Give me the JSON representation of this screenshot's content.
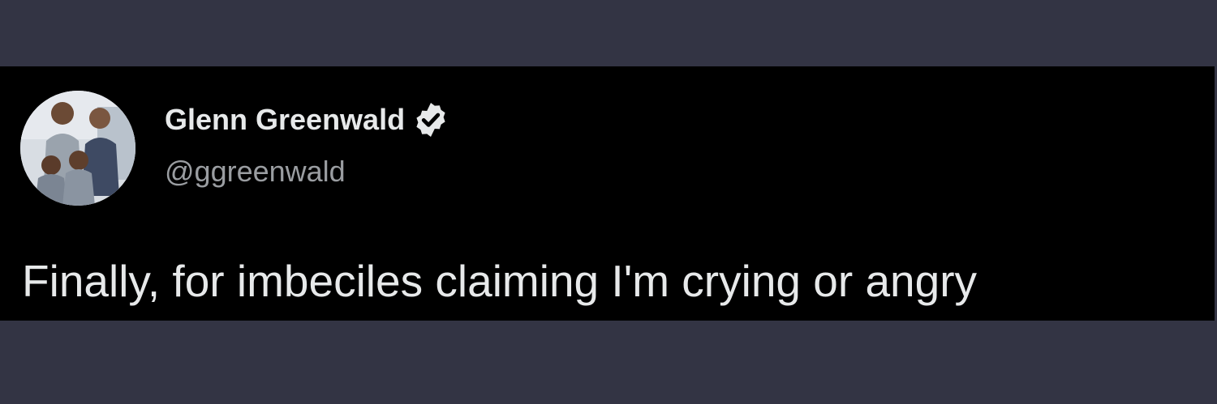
{
  "tweet": {
    "author": {
      "display_name": "Glenn Greenwald",
      "handle": "@ggreenwald",
      "verified": true,
      "verified_icon": "verified-badge-icon",
      "avatar": "profile-photo"
    },
    "text": "Finally, for imbeciles claiming I'm crying or angry"
  },
  "colors": {
    "page_background": "#333444",
    "card_background": "#000000",
    "primary_text": "#e7e9ea",
    "secondary_text": "#9a9da1"
  }
}
